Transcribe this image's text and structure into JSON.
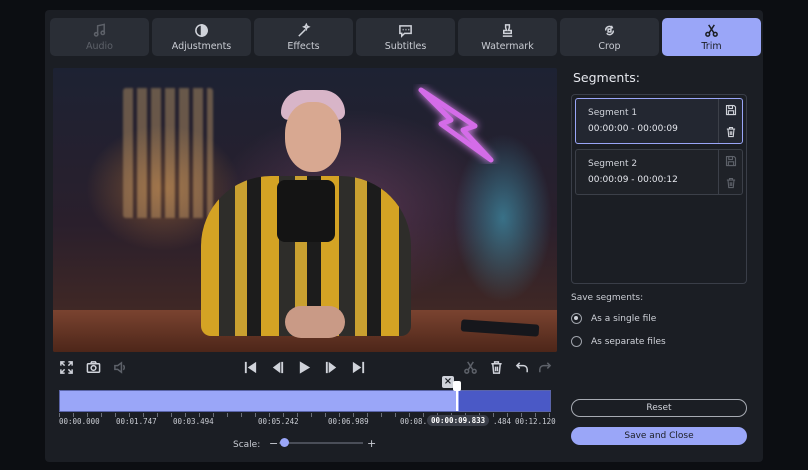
{
  "tabs": [
    {
      "label": "Audio",
      "icon": "music-note-icon",
      "state": "disabled"
    },
    {
      "label": "Adjustments",
      "icon": "contrast-icon",
      "state": "normal"
    },
    {
      "label": "Effects",
      "icon": "magic-wand-icon",
      "state": "normal"
    },
    {
      "label": "Subtitles",
      "icon": "speech-bubble-icon",
      "state": "normal"
    },
    {
      "label": "Watermark",
      "icon": "stamp-icon",
      "state": "normal"
    },
    {
      "label": "Crop",
      "icon": "crop-rotate-icon",
      "state": "normal"
    },
    {
      "label": "Trim",
      "icon": "scissors-icon",
      "state": "active"
    }
  ],
  "player": {
    "controls": [
      "fullscreen-icon",
      "camera-icon",
      "volume-icon",
      "skip-start-icon",
      "step-back-icon",
      "play-icon",
      "step-forward-icon",
      "skip-end-icon",
      "scissors-icon",
      "trash-icon",
      "undo-icon",
      "redo-icon"
    ]
  },
  "timeline": {
    "labels": [
      "00:00.000",
      "00:01.747",
      "00:03.494",
      "00:05.242",
      "00:06.989",
      "00:08.7",
      "00:00:09.833",
      ".484",
      "00:12.120"
    ],
    "current_time": "00:00:09.833",
    "remove_marker": "×"
  },
  "scale": {
    "label": "Scale:",
    "minus": "−",
    "plus": "+"
  },
  "segments": {
    "title": "Segments:",
    "items": [
      {
        "name": "Segment 1",
        "range": "00:00:00 - 00:00:09",
        "selected": true
      },
      {
        "name": "Segment 2",
        "range": "00:00:09 - 00:00:12",
        "selected": false
      }
    ]
  },
  "save_segments": {
    "label": "Save segments:",
    "options": [
      {
        "label": "As a single file",
        "checked": true
      },
      {
        "label": "As separate files",
        "checked": false
      }
    ]
  },
  "buttons": {
    "reset": "Reset",
    "save_close": "Save and Close"
  },
  "colors": {
    "accent": "#9aa6f8",
    "panel": "#1b1e24",
    "tab_bg": "#2a2e36"
  }
}
